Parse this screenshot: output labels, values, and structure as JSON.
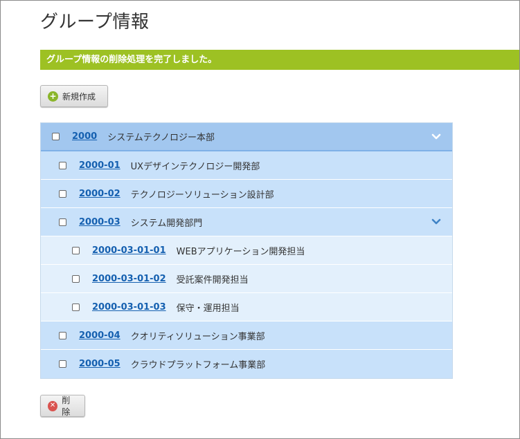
{
  "page": {
    "title": "グループ情報",
    "notice": "グループ情報の削除処理を完了しました。"
  },
  "toolbar": {
    "new_label": "新規作成",
    "delete_label": "削除"
  },
  "icons": {
    "new": "plus-circle-icon",
    "delete": "x-circle-icon",
    "expand": "chevron-down-icon"
  },
  "colors": {
    "notice_bg": "#9dc123",
    "link": "#1560b0",
    "row_level0": "#a2c7ef",
    "row_level1": "#c8e1fa",
    "row_level2": "#e3f0fc"
  },
  "groups": [
    {
      "code": "2000",
      "name": "システムテクノロジー本部",
      "level": 0,
      "expanded": true,
      "checked": false
    },
    {
      "code": "2000-01",
      "name": "UXデザインテクノロジー開発部",
      "level": 1,
      "checked": false
    },
    {
      "code": "2000-02",
      "name": "テクノロジーソリューション設計部",
      "level": 1,
      "checked": false
    },
    {
      "code": "2000-03",
      "name": "システム開発部門",
      "level": 1,
      "expanded": true,
      "checked": false
    },
    {
      "code": "2000-03-01-01",
      "name": "WEBアプリケーション開発担当",
      "level": 2,
      "checked": false
    },
    {
      "code": "2000-03-01-02",
      "name": "受託案件開発担当",
      "level": 2,
      "checked": false
    },
    {
      "code": "2000-03-01-03",
      "name": "保守・運用担当",
      "level": 2,
      "checked": false
    },
    {
      "code": "2000-04",
      "name": "クオリティソリューション事業部",
      "level": 1,
      "checked": false
    },
    {
      "code": "2000-05",
      "name": "クラウドプラットフォーム事業部",
      "level": 1,
      "checked": false
    }
  ]
}
